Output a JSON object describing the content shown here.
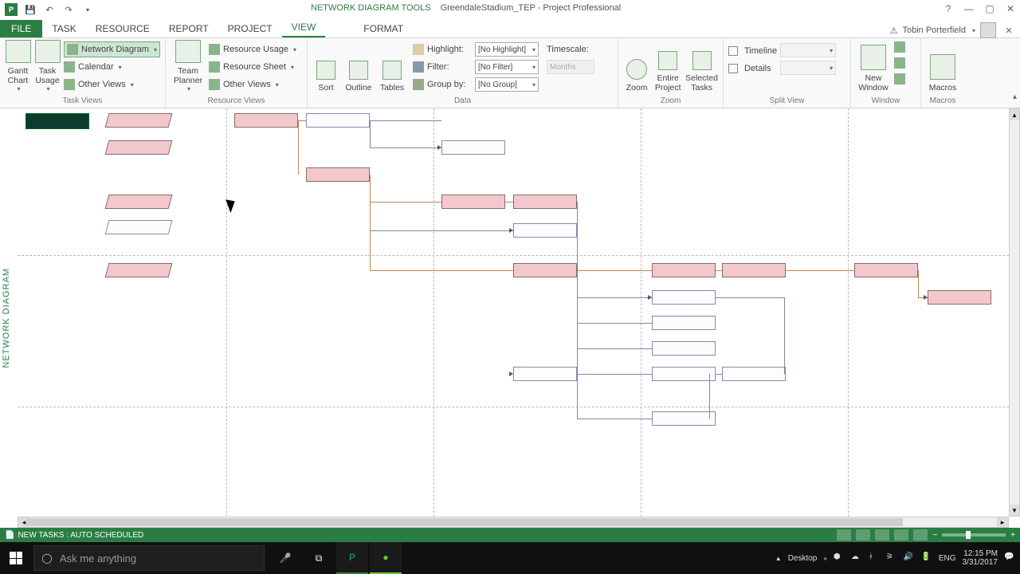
{
  "app": {
    "tool_tab": "NETWORK DIAGRAM TOOLS",
    "doc_title": "GreendaleStadium_TEP - Project Professional"
  },
  "qat": {
    "icon_letter": "P"
  },
  "tabs": {
    "file": "FILE",
    "task": "TASK",
    "resource": "RESOURCE",
    "report": "REPORT",
    "project": "PROJECT",
    "view": "VIEW",
    "format": "FORMAT"
  },
  "user": {
    "warn": "⚠",
    "name": "Tobin Porterfield"
  },
  "ribbon": {
    "task_views": {
      "gantt": "Gantt\nChart",
      "task_usage": "Task\nUsage",
      "network_diagram": "Network Diagram",
      "calendar": "Calendar",
      "other_views": "Other Views",
      "label": "Task Views"
    },
    "resource_views": {
      "team_planner": "Team\nPlanner",
      "resource_usage": "Resource Usage",
      "resource_sheet": "Resource Sheet",
      "other_views": "Other Views",
      "label": "Resource Views"
    },
    "data": {
      "sort": "Sort",
      "outline": "Outline",
      "tables": "Tables",
      "highlight_label": "Highlight:",
      "highlight_value": "[No Highlight]",
      "filter_label": "Filter:",
      "filter_value": "[No Filter]",
      "group_label": "Group by:",
      "group_value": "[No Group]",
      "timescale_label": "Timescale:",
      "timescale_value": "Months",
      "label": "Data"
    },
    "zoom": {
      "zoom": "Zoom",
      "entire": "Entire\nProject",
      "selected": "Selected\nTasks",
      "label": "Zoom"
    },
    "split": {
      "timeline": "Timeline",
      "details": "Details",
      "label": "Split View"
    },
    "window": {
      "new_window": "New\nWindow",
      "label": "Window"
    },
    "macros": {
      "macros": "Macros",
      "label": "Macros"
    }
  },
  "sidebar": "NETWORK DIAGRAM",
  "status": {
    "left": "NEW TASKS : AUTO SCHEDULED"
  },
  "taskbar": {
    "search_placeholder": "Ask me anything",
    "desktop": "Desktop",
    "lang": "ENG",
    "time": "12:15 PM",
    "date": "3/31/2017"
  }
}
